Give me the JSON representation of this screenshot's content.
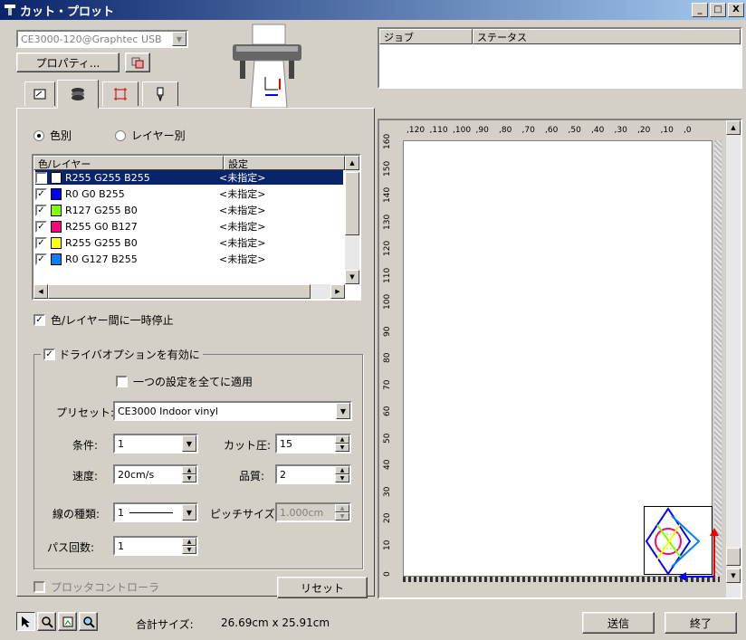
{
  "window": {
    "title": "カット・プロット",
    "minimize": "_",
    "maximize": "□",
    "close": "X"
  },
  "device": {
    "selected": "CE3000-120@Graphtec USB",
    "properties_button": "プロパティ..."
  },
  "job_table": {
    "col_job": "ジョブ",
    "col_status": "ステータス"
  },
  "tabs": [
    {
      "icon": "plot-tab-icon"
    },
    {
      "icon": "layers-tab-icon"
    },
    {
      "icon": "marks-tab-icon"
    },
    {
      "icon": "tool-tab-icon"
    }
  ],
  "mode": {
    "by_color": "色別",
    "by_layer": "レイヤー別",
    "selected": "by_color"
  },
  "layer_table": {
    "col_layer": "色/レイヤー",
    "col_setting": "設定",
    "rows": [
      {
        "checked": true,
        "color": "#ffffff",
        "name": "R255 G255 B255",
        "setting": "<未指定>",
        "selected": true
      },
      {
        "checked": true,
        "color": "#0000ff",
        "name": "R0 G0 B255",
        "setting": "<未指定>"
      },
      {
        "checked": true,
        "color": "#7fff00",
        "name": "R127 G255 B0",
        "setting": "<未指定>"
      },
      {
        "checked": true,
        "color": "#ff007f",
        "name": "R255 G0 B127",
        "setting": "<未指定>"
      },
      {
        "checked": true,
        "color": "#ffff00",
        "name": "R255 G255 B0",
        "setting": "<未指定>"
      },
      {
        "checked": true,
        "color": "#007fff",
        "name": "R0 G127 B255",
        "setting": "<未指定>"
      }
    ]
  },
  "pause_between": {
    "label": "色/レイヤー間に一時停止",
    "checked": true
  },
  "driver_options": {
    "label": "ドライバオプションを有効に",
    "checked": true,
    "apply_all": {
      "label": "一つの設定を全てに適用",
      "checked": false
    },
    "preset_label": "プリセット:",
    "preset_value": "CE3000 Indoor vinyl",
    "condition_label": "条件:",
    "condition_value": "1",
    "force_label": "カット圧:",
    "force_value": "15",
    "speed_label": "速度:",
    "speed_value": "20cm/s",
    "quality_label": "品質:",
    "quality_value": "2",
    "linetype_label": "線の種類:",
    "linetype_value": "1",
    "pitch_label": "ピッチサイズ:",
    "pitch_value": "1.000cm",
    "passes_label": "パス回数:",
    "passes_value": "1"
  },
  "plotter_controller": {
    "label": "プロッタコントローラ",
    "checked": false
  },
  "reset_button": "リセット",
  "ruler_top": [
    ",120",
    ",110",
    ",100",
    ",90",
    ",80",
    ",70",
    ",60",
    ",50",
    ",40",
    ",30",
    ",20",
    ",10",
    ",0"
  ],
  "ruler_left": [
    "160",
    "150",
    "140",
    "130",
    "120",
    "110",
    "100",
    "90",
    "80",
    "70",
    "60",
    "50",
    "40",
    "30",
    "20",
    "10",
    "0"
  ],
  "status": {
    "total_size_label": "合計サイズ:",
    "total_size_value": "26.69cm x 25.91cm"
  },
  "send_button": "送信",
  "exit_button": "終了"
}
